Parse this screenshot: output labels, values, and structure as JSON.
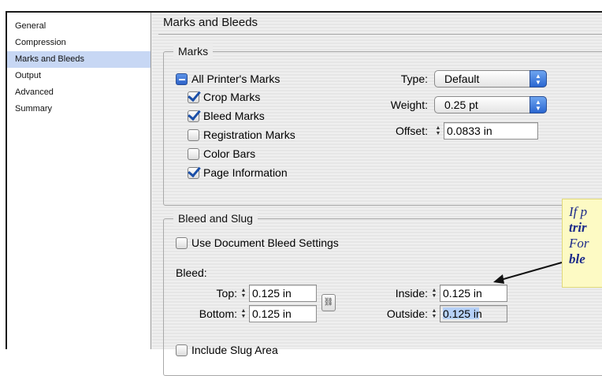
{
  "sidebar": {
    "items": [
      {
        "label": "General"
      },
      {
        "label": "Compression"
      },
      {
        "label": "Marks and Bleeds",
        "selected": true
      },
      {
        "label": "Output"
      },
      {
        "label": "Advanced"
      },
      {
        "label": "Summary"
      }
    ]
  },
  "page": {
    "title": "Marks and Bleeds"
  },
  "marks": {
    "group_label": "Marks",
    "all_printers_marks": {
      "label": "All Printer's Marks",
      "state": "mixed"
    },
    "crop_marks": {
      "label": "Crop Marks",
      "checked": true
    },
    "bleed_marks": {
      "label": "Bleed Marks",
      "checked": true
    },
    "registration_marks": {
      "label": "Registration Marks",
      "checked": false
    },
    "color_bars": {
      "label": "Color Bars",
      "checked": false
    },
    "page_information": {
      "label": "Page Information",
      "checked": true
    },
    "type": {
      "label": "Type:",
      "value": "Default"
    },
    "weight": {
      "label": "Weight:",
      "value": "0.25 pt"
    },
    "offset": {
      "label": "Offset:",
      "value": "0.0833 in"
    }
  },
  "bleed_slug": {
    "group_label": "Bleed and Slug",
    "use_document_bleed": {
      "label": "Use Document Bleed Settings",
      "checked": false
    },
    "bleed_label": "Bleed:",
    "top": {
      "label": "Top:",
      "value": "0.125 in"
    },
    "bottom": {
      "label": "Bottom:",
      "value": "0.125 in"
    },
    "inside": {
      "label": "Inside:",
      "value": "0.125 in"
    },
    "outside": {
      "label": "Outside:",
      "value": "0.125 in"
    },
    "include_slug": {
      "label": "Include Slug Area",
      "checked": false
    }
  },
  "callout": {
    "line1": "If p",
    "line2": "trir",
    "line3": "For",
    "line4": "ble"
  },
  "colors": {
    "selection": "#c7d7f4",
    "accent_blue": "#2a66d0",
    "callout_bg": "#fdfac4",
    "callout_text": "#1c2a8a"
  }
}
